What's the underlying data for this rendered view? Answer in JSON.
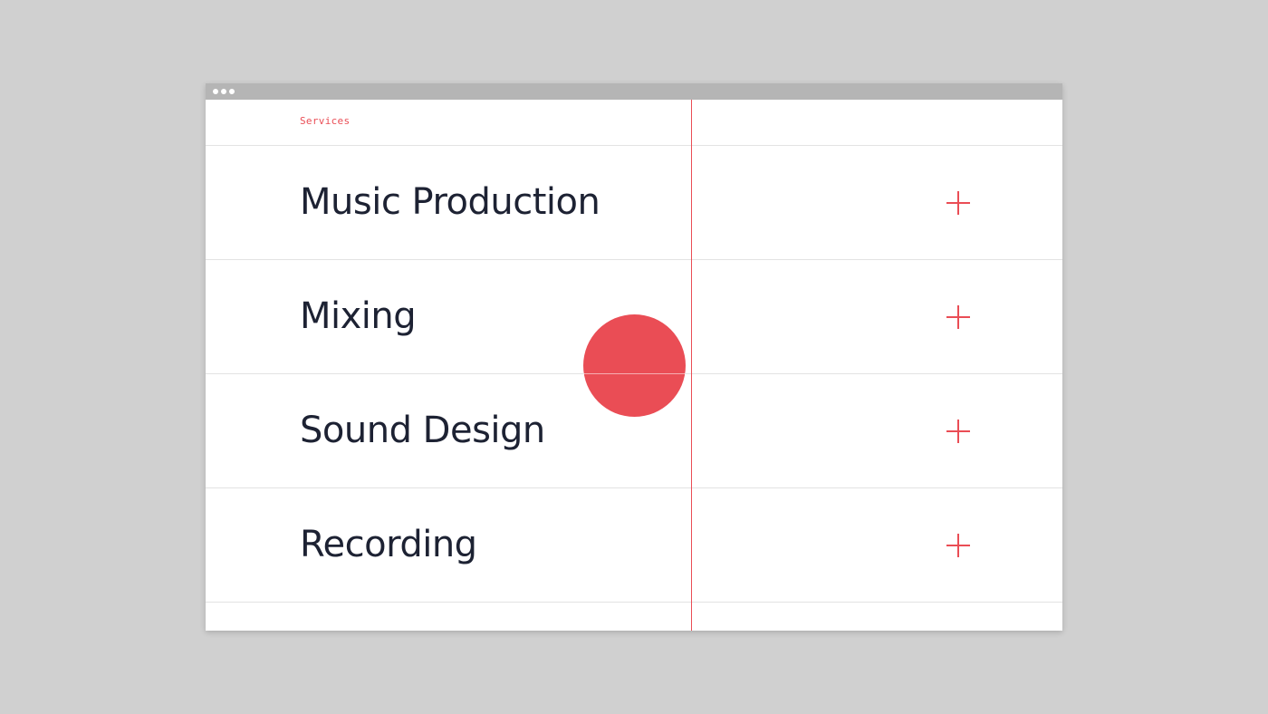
{
  "theme": {
    "accent": "#ea4d55",
    "line": "#e3e3e3",
    "text": "#1d2233",
    "window_chrome": "#b5b5b5",
    "backdrop": "#d0d0d0"
  },
  "window": {
    "controls": [
      "dot",
      "dot",
      "dot"
    ]
  },
  "section": {
    "label": "Services"
  },
  "services": [
    {
      "title": "Music Production",
      "icon": "plus-icon"
    },
    {
      "title": "Mixing",
      "icon": "plus-icon"
    },
    {
      "title": "Sound Design",
      "icon": "plus-icon"
    },
    {
      "title": "Recording",
      "icon": "plus-icon"
    }
  ],
  "decor": {
    "record_dot_color": "#ea4d55",
    "guide_line_color": "#ea4d55"
  }
}
